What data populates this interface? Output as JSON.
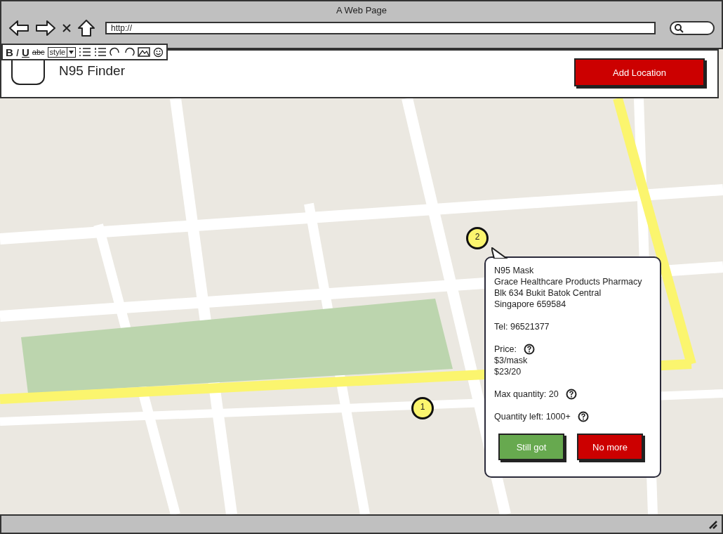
{
  "window": {
    "title": "A Web Page"
  },
  "address_bar": {
    "value": "http://"
  },
  "format_toolbar": {
    "items": [
      {
        "kind": "bold",
        "label": "B"
      },
      {
        "kind": "italic",
        "label": "I"
      },
      {
        "kind": "underline",
        "label": "U"
      },
      {
        "kind": "strike",
        "label": "abc"
      },
      {
        "kind": "dropdown",
        "label": "style"
      }
    ]
  },
  "header": {
    "title": "N95 Finder",
    "button": "Add Location"
  },
  "map": {
    "pins": [
      {
        "label": "2"
      },
      {
        "label": "1"
      }
    ]
  },
  "popup": {
    "lines": [
      "N95 Mask",
      "Grace Healthcare Products Pharmacy",
      "Blk 634 Bukit Batok Central",
      "Singapore 659584"
    ],
    "tel": "Tel: 96521377",
    "price_label": "Price:",
    "prices": [
      "$3/mask",
      "$23/20"
    ],
    "max_quantity": "Max quantity: 20",
    "quantity_left": "Quantity left: 1000+",
    "buttons": [
      {
        "kind": "confirm",
        "label": "Still got"
      },
      {
        "kind": "deny",
        "label": "No more"
      }
    ]
  }
}
